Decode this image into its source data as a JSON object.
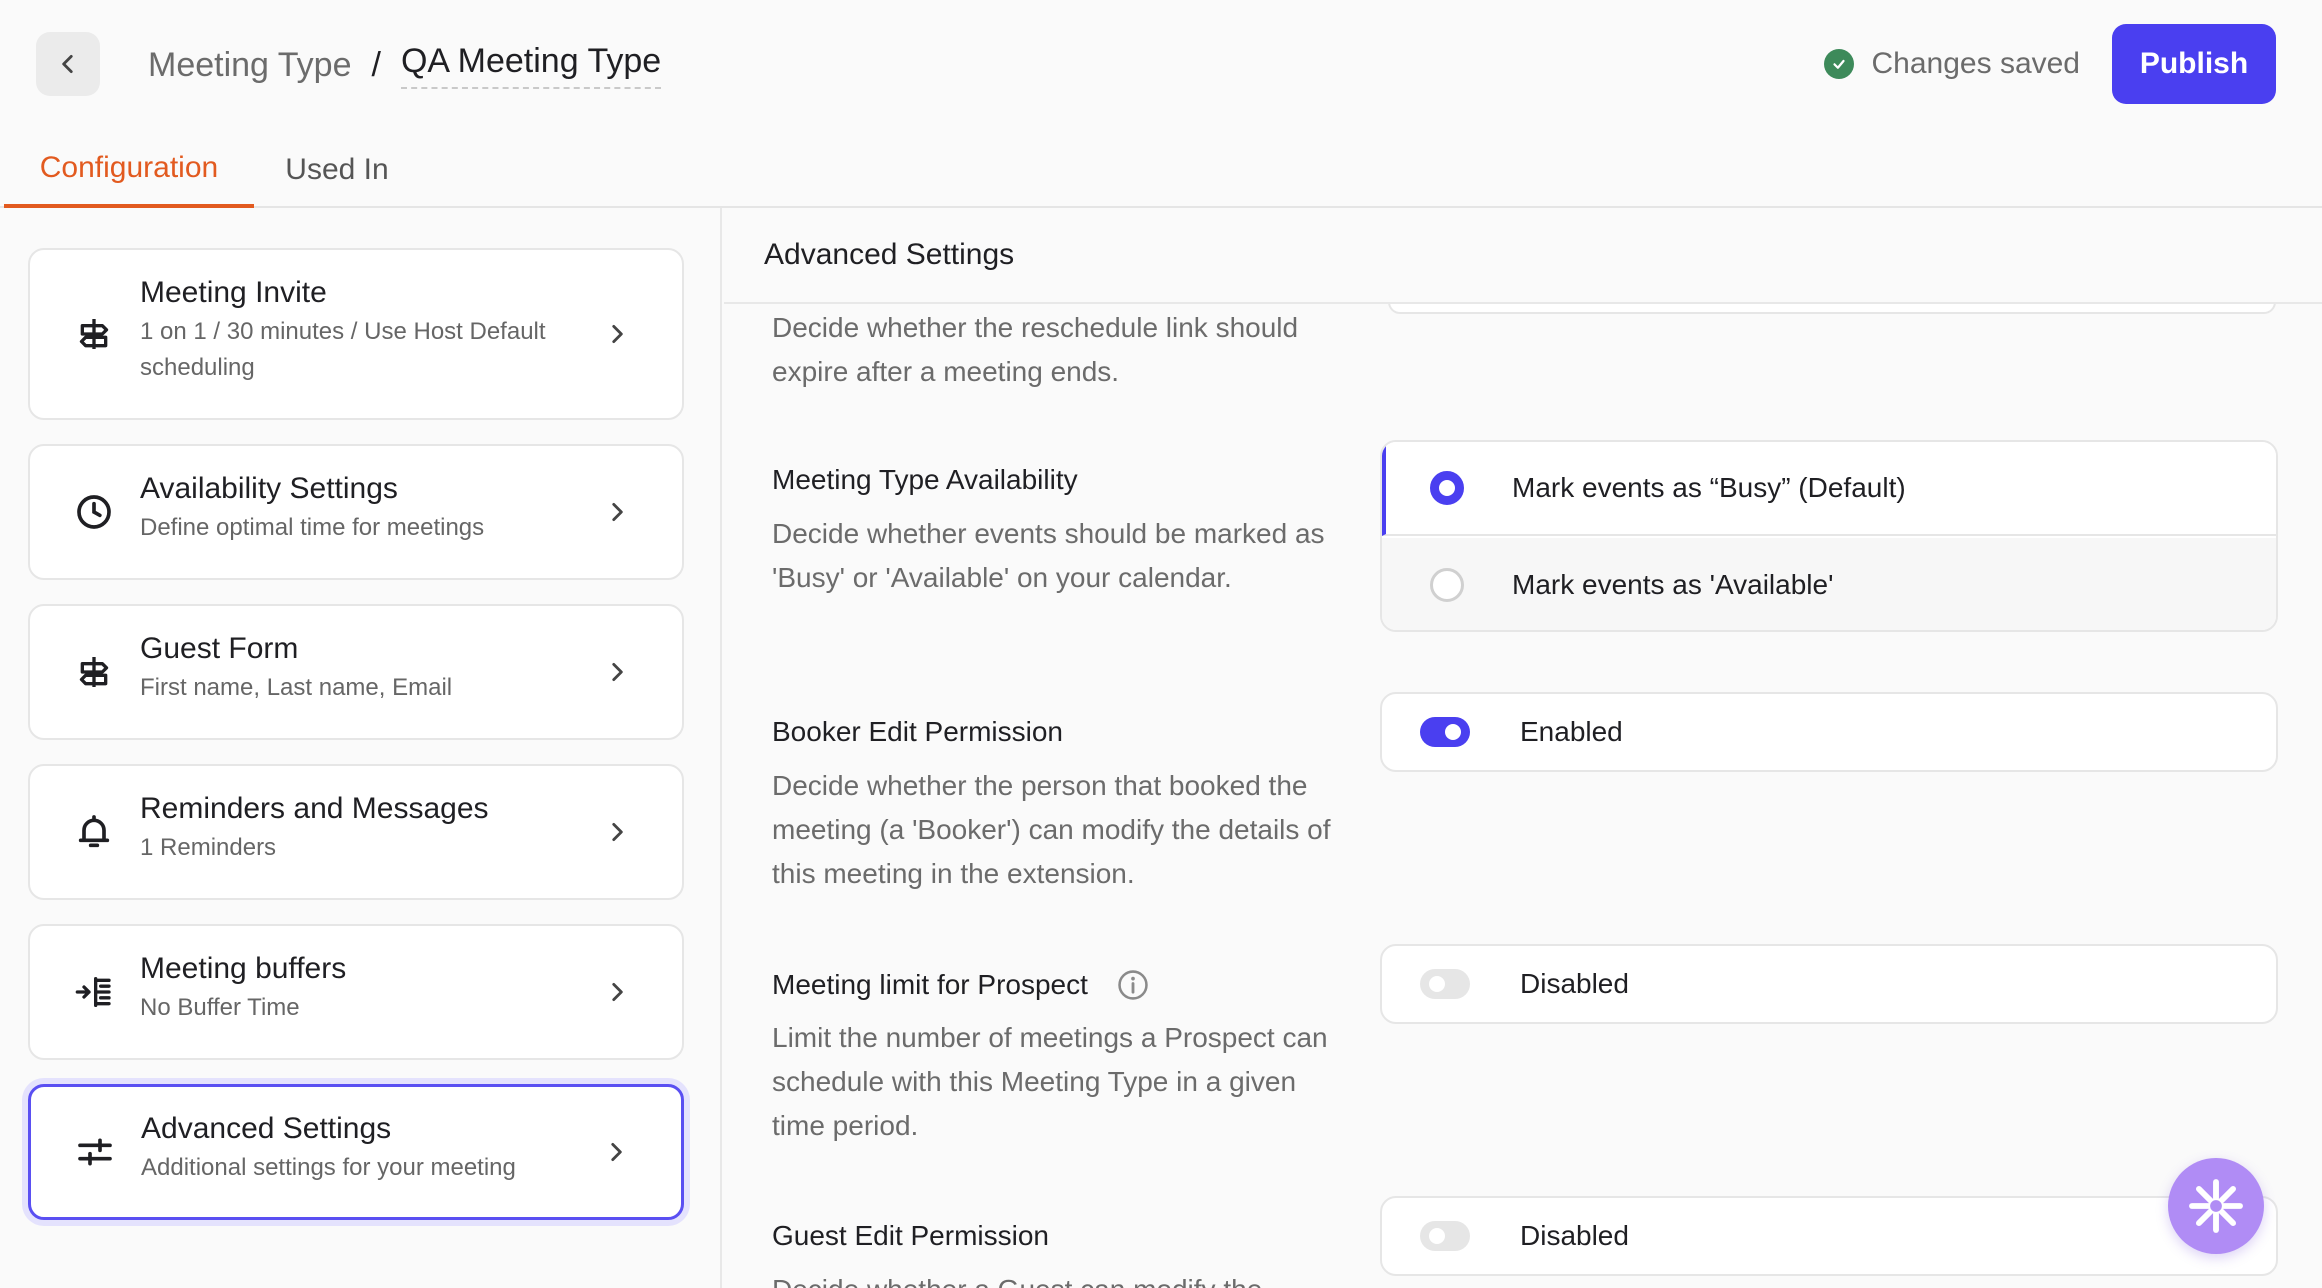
{
  "header": {
    "breadcrumb_parent": "Meeting Type",
    "breadcrumb_separator": "/",
    "breadcrumb_current": "QA Meeting Type",
    "save_status": "Changes saved",
    "publish_label": "Publish"
  },
  "tabs": [
    {
      "label": "Configuration",
      "active": true
    },
    {
      "label": "Used In",
      "active": false
    }
  ],
  "sidebar": {
    "items": [
      {
        "title": "Meeting Invite",
        "subtitle": "1 on 1 / 30 minutes / Use Host Default scheduling",
        "icon": "signpost-icon"
      },
      {
        "title": "Availability Settings",
        "subtitle": "Define optimal time for meetings",
        "icon": "clock-icon"
      },
      {
        "title": "Guest Form",
        "subtitle": "First name, Last name, Email",
        "icon": "signpost-icon"
      },
      {
        "title": "Reminders and Messages",
        "subtitle": "1 Reminders",
        "icon": "bell-icon"
      },
      {
        "title": "Meeting buffers",
        "subtitle": "No Buffer Time",
        "icon": "buffer-icon"
      },
      {
        "title": "Advanced Settings",
        "subtitle": "Additional settings for your meeting",
        "icon": "sliders-icon",
        "active": true
      }
    ]
  },
  "main": {
    "title": "Advanced Settings",
    "prev_desc": "Decide whether the reschedule link should expire after a meeting ends.",
    "availability": {
      "title": "Meeting Type Availability",
      "desc": "Decide whether events should be marked as 'Busy' or 'Available' on your calendar.",
      "options": [
        {
          "label": "Mark events as “Busy” (Default)",
          "selected": true
        },
        {
          "label": "Mark events as 'Available'",
          "selected": false
        }
      ]
    },
    "booker_edit": {
      "title": "Booker Edit Permission",
      "desc": "Decide whether the person that booked the meeting (a 'Booker') can modify the details of this meeting in the extension.",
      "state": "Enabled"
    },
    "meeting_limit": {
      "title": "Meeting limit for Prospect",
      "desc": "Limit the number of meetings a Prospect can schedule with this Meeting Type in a given time period.",
      "state": "Disabled"
    },
    "guest_edit": {
      "title": "Guest Edit Permission",
      "desc": "Decide whether a Guest can modify the",
      "state": "Disabled"
    }
  },
  "colors": {
    "accent": "#4a3ff0",
    "tab_active": "#e25a1f",
    "success": "#3d8a5a",
    "fab": "#b08cf5"
  }
}
